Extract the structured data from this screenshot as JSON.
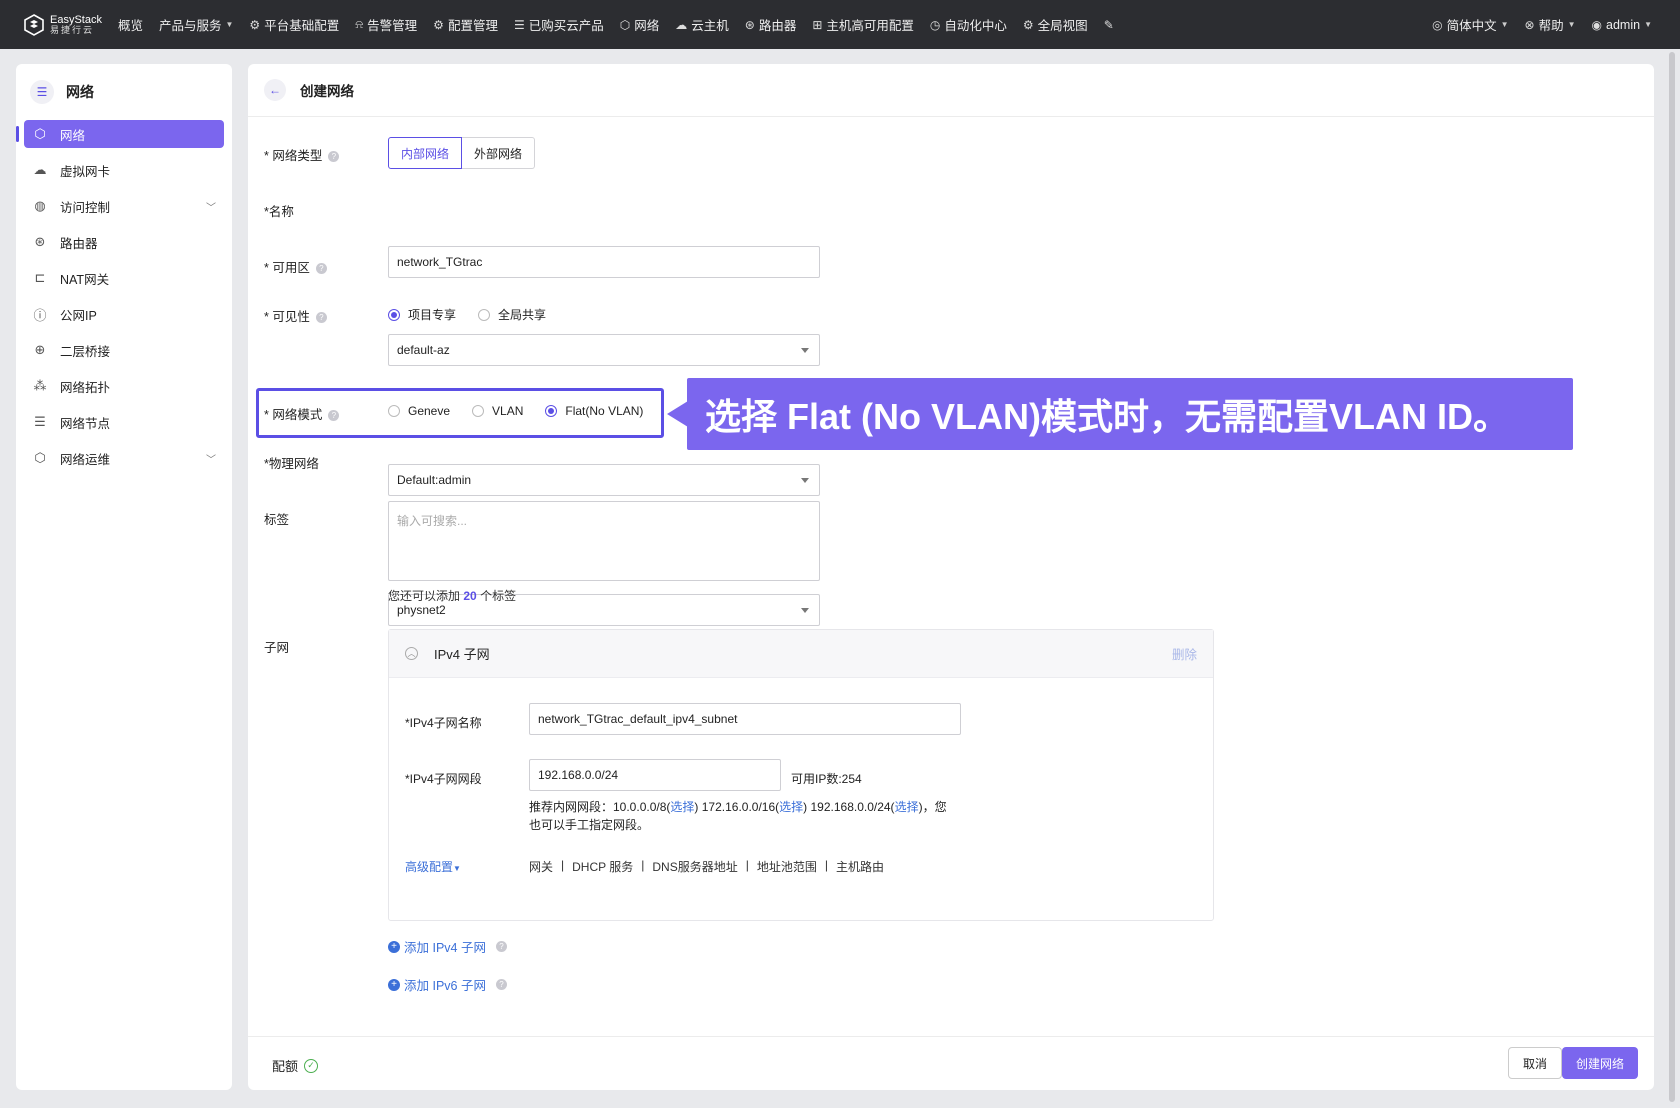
{
  "topbar": {
    "logo_line1": "EasyStack",
    "logo_line2": "易捷行云",
    "nav": [
      {
        "label": "概览",
        "icon": ""
      },
      {
        "label": "产品与服务",
        "icon": "",
        "caret": true
      },
      {
        "label": "平台基础配置",
        "icon": "gear-icon"
      },
      {
        "label": "告警管理",
        "icon": "alarm-icon"
      },
      {
        "label": "配置管理",
        "icon": "settings-icon"
      },
      {
        "label": "已购买云产品",
        "icon": "list-icon"
      },
      {
        "label": "网络",
        "icon": "network-icon"
      },
      {
        "label": "云主机",
        "icon": "cloud-icon"
      },
      {
        "label": "路由器",
        "icon": "router-icon"
      },
      {
        "label": "主机高可用配置",
        "icon": "ha-icon"
      },
      {
        "label": "自动化中心",
        "icon": "auto-icon"
      },
      {
        "label": "全局视图",
        "icon": "globe-icon"
      }
    ],
    "language": "简体中文",
    "help": "帮助",
    "user": "admin"
  },
  "sidebar": {
    "title": "网络",
    "items": [
      {
        "label": "网络",
        "icon": "network-icon",
        "active": true
      },
      {
        "label": "虚拟网卡",
        "icon": "nic-icon"
      },
      {
        "label": "访问控制",
        "icon": "access-icon",
        "expandable": true
      },
      {
        "label": "路由器",
        "icon": "router-icon"
      },
      {
        "label": "NAT网关",
        "icon": "nat-icon"
      },
      {
        "label": "公网IP",
        "icon": "ip-icon"
      },
      {
        "label": "二层桥接",
        "icon": "bridge-icon"
      },
      {
        "label": "网络拓扑",
        "icon": "topology-icon"
      },
      {
        "label": "网络节点",
        "icon": "node-icon"
      },
      {
        "label": "网络运维",
        "icon": "ops-icon",
        "expandable": true
      }
    ]
  },
  "page": {
    "title": "创建网络"
  },
  "form": {
    "network_type": {
      "label": "* 网络类型",
      "options": [
        "内部网络",
        "外部网络"
      ],
      "selected": "内部网络"
    },
    "name": {
      "label": "*名称",
      "value": "network_TGtrac"
    },
    "az": {
      "label": "* 可用区",
      "value": "default-az"
    },
    "visibility": {
      "label": "* 可见性",
      "options": [
        "项目专享",
        "全局共享"
      ],
      "selected": "项目专享",
      "project": "Default:admin"
    },
    "mode": {
      "label": "* 网络模式",
      "options": [
        "Geneve",
        "VLAN",
        "Flat(No VLAN)"
      ],
      "selected": "Flat(No VLAN)"
    },
    "physical": {
      "label": "*物理网络",
      "value": "physnet2"
    },
    "tags": {
      "label": "标签",
      "placeholder": "输入可搜索...",
      "hint_pre": "您还可以添加",
      "hint_count": "20",
      "hint_post": "个标签"
    },
    "subnet_label": "子网"
  },
  "subnet": {
    "title": "IPv4 子网",
    "delete": "删除",
    "name_label": "*IPv4子网名称",
    "name_value": "network_TGtrac_default_ipv4_subnet",
    "cidr_label": "*IPv4子网网段",
    "cidr_value": "192.168.0.0/24",
    "available_ips": "可用IP数:254",
    "rec_prefix": "推荐内网网段：10.0.0.0/8(",
    "choose": "选择",
    "rec_2": ") 172.16.0.0/16(",
    "rec_3": ") 192.168.0.0/24(",
    "rec_suffix": ")，您",
    "rec_line2": "也可以手工指定网段。",
    "advanced": "高级配置",
    "advanced_items": [
      "网关",
      "DHCP 服务",
      "DNS服务器地址",
      "地址池范围",
      "主机路由"
    ]
  },
  "add_ipv4": "添加 IPv4 子网",
  "add_ipv6": "添加 IPv6 子网",
  "footer": {
    "quota": "配额",
    "cancel": "取消",
    "create": "创建网络"
  },
  "callout": {
    "text": "选择 Flat (No VLAN)模式时，无需配置VLAN ID。"
  },
  "colors": {
    "accent": "#7b66ee",
    "topbar": "#2c2d31",
    "link": "#3b6fd8"
  }
}
